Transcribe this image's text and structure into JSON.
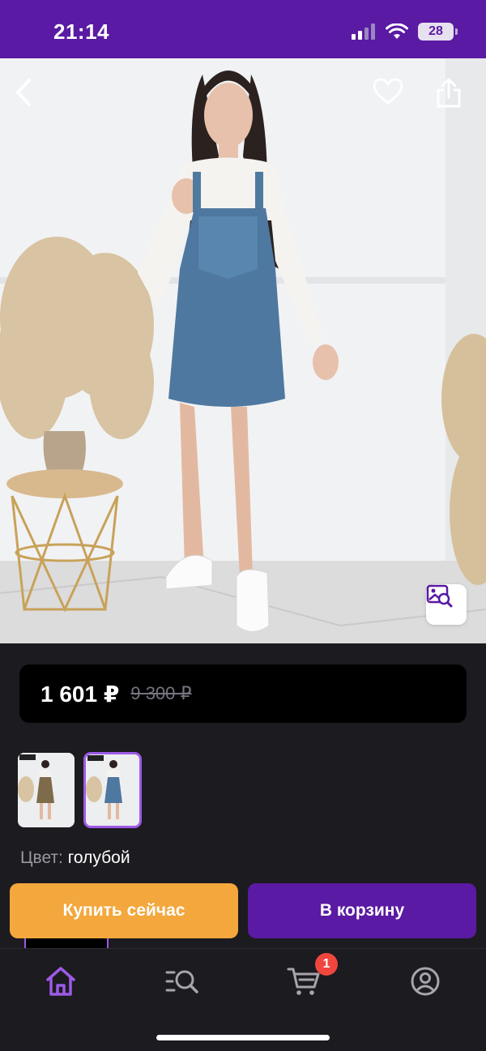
{
  "status_bar": {
    "time": "21:14",
    "battery": "28"
  },
  "product": {
    "price_current": "1 601 ₽",
    "price_old": "9 300 ₽",
    "color_label": "Цвет:",
    "color_value": "голубой"
  },
  "icons": {
    "back": "chevron-left-icon",
    "favorite": "heart-icon",
    "share": "share-icon",
    "visual_search": "image-search-icon"
  },
  "actions": {
    "buy_now": "Купить сейчас",
    "add_to_cart": "В корзину"
  },
  "tabbar": {
    "items": [
      "home",
      "catalog-search",
      "cart",
      "profile"
    ],
    "cart_badge": "1",
    "active_color": "#9d5ae6"
  },
  "colors": {
    "brand": "#5a1aa3",
    "accent_orange": "#f3a73c",
    "badge": "#f0463e",
    "background": "#1c1b20"
  }
}
